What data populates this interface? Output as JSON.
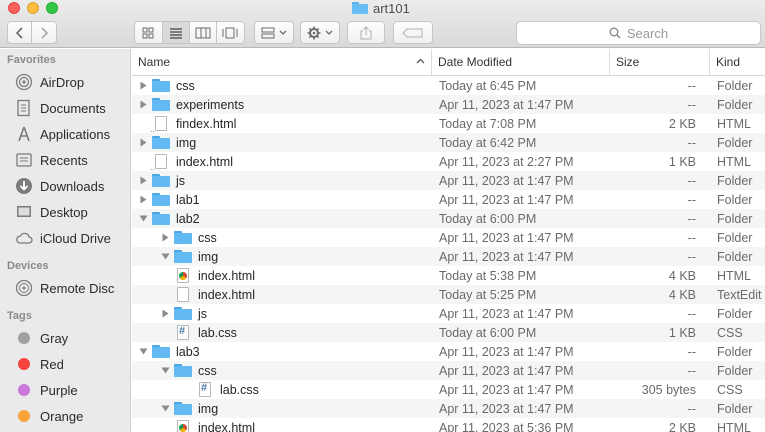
{
  "window": {
    "title": "art101"
  },
  "toolbar": {
    "back_icon": "chevron-left-icon",
    "forward_icon": "chevron-right-icon",
    "search_placeholder": "Search"
  },
  "sidebar": {
    "favorites_header": "Favorites",
    "favorites": [
      {
        "label": "AirDrop",
        "icon": "airdrop-icon"
      },
      {
        "label": "Documents",
        "icon": "documents-icon"
      },
      {
        "label": "Applications",
        "icon": "applications-icon"
      },
      {
        "label": "Recents",
        "icon": "recents-icon"
      },
      {
        "label": "Downloads",
        "icon": "downloads-icon"
      },
      {
        "label": "Desktop",
        "icon": "desktop-icon"
      },
      {
        "label": "iCloud Drive",
        "icon": "icloud-icon"
      }
    ],
    "devices_header": "Devices",
    "devices": [
      {
        "label": "Remote Disc",
        "icon": "disc-icon"
      }
    ],
    "tags_header": "Tags",
    "tags": [
      {
        "label": "Gray",
        "color": "#a0a0a0"
      },
      {
        "label": "Red",
        "color": "#f4453c"
      },
      {
        "label": "Purple",
        "color": "#c879d9"
      },
      {
        "label": "Orange",
        "color": "#f8a43b"
      }
    ]
  },
  "columns": {
    "name": "Name",
    "date": "Date Modified",
    "size": "Size",
    "kind": "Kind"
  },
  "rows": [
    {
      "depth": 0,
      "disc": "closed",
      "type": "folder",
      "name": "css",
      "date": "Today at 6:45 PM",
      "size": "--",
      "kind": "Folder"
    },
    {
      "depth": 0,
      "disc": "closed",
      "type": "folder",
      "name": "experiments",
      "date": "Apr 11, 2023 at 1:47 PM",
      "size": "--",
      "kind": "Folder"
    },
    {
      "depth": 0,
      "disc": "none",
      "type": "html",
      "name": "findex.html",
      "date": "Today at 7:08 PM",
      "size": "2 KB",
      "kind": "HTML"
    },
    {
      "depth": 0,
      "disc": "closed",
      "type": "folder",
      "name": "img",
      "date": "Today at 6:42 PM",
      "size": "--",
      "kind": "Folder"
    },
    {
      "depth": 0,
      "disc": "none",
      "type": "html",
      "name": "index.html",
      "date": "Apr 11, 2023 at 2:27 PM",
      "size": "1 KB",
      "kind": "HTML"
    },
    {
      "depth": 0,
      "disc": "closed",
      "type": "folder",
      "name": "js",
      "date": "Apr 11, 2023 at 1:47 PM",
      "size": "--",
      "kind": "Folder"
    },
    {
      "depth": 0,
      "disc": "closed",
      "type": "folder",
      "name": "lab1",
      "date": "Apr 11, 2023 at 1:47 PM",
      "size": "--",
      "kind": "Folder"
    },
    {
      "depth": 0,
      "disc": "open",
      "type": "folder",
      "name": "lab2",
      "date": "Today at 6:00 PM",
      "size": "--",
      "kind": "Folder"
    },
    {
      "depth": 1,
      "disc": "closed",
      "type": "folder",
      "name": "css",
      "date": "Apr 11, 2023 at 1:47 PM",
      "size": "--",
      "kind": "Folder"
    },
    {
      "depth": 1,
      "disc": "open",
      "type": "folder",
      "name": "img",
      "date": "Apr 11, 2023 at 1:47 PM",
      "size": "--",
      "kind": "Folder"
    },
    {
      "depth": 1,
      "disc": "none",
      "type": "chrome",
      "name": "index.html",
      "date": "Today at 5:38 PM",
      "size": "4 KB",
      "kind": "HTML"
    },
    {
      "depth": 1,
      "disc": "none",
      "type": "text",
      "name": "index.html",
      "date": "Today at 5:25 PM",
      "size": "4 KB",
      "kind": "TextEdit"
    },
    {
      "depth": 1,
      "disc": "closed",
      "type": "folder",
      "name": "js",
      "date": "Apr 11, 2023 at 1:47 PM",
      "size": "--",
      "kind": "Folder"
    },
    {
      "depth": 1,
      "disc": "none",
      "type": "css",
      "name": "lab.css",
      "date": "Today at 6:00 PM",
      "size": "1 KB",
      "kind": "CSS"
    },
    {
      "depth": 0,
      "disc": "open",
      "type": "folder",
      "name": "lab3",
      "date": "Apr 11, 2023 at 1:47 PM",
      "size": "--",
      "kind": "Folder"
    },
    {
      "depth": 1,
      "disc": "open",
      "type": "folder",
      "name": "css",
      "date": "Apr 11, 2023 at 1:47 PM",
      "size": "--",
      "kind": "Folder"
    },
    {
      "depth": 2,
      "disc": "none",
      "type": "css",
      "name": "lab.css",
      "date": "Apr 11, 2023 at 1:47 PM",
      "size": "305 bytes",
      "kind": "CSS"
    },
    {
      "depth": 1,
      "disc": "open",
      "type": "folder",
      "name": "img",
      "date": "Apr 11, 2023 at 1:47 PM",
      "size": "--",
      "kind": "Folder"
    },
    {
      "depth": 1,
      "disc": "none",
      "type": "chrome",
      "name": "index.html",
      "date": "Apr 11, 2023 at 5:36 PM",
      "size": "2 KB",
      "kind": "HTML"
    }
  ]
}
